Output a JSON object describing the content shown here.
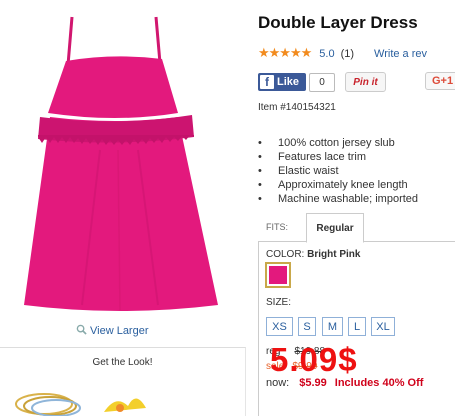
{
  "product": {
    "title": "Double Layer Dress",
    "rating": {
      "stars": "★★★★★",
      "score": "5.0",
      "count": "(1)",
      "write_review": "Write a rev"
    },
    "item_number": "Item #140154321",
    "features": [
      "100% cotton jersey slub",
      "Features lace trim",
      "Elastic waist",
      "Approximately knee length",
      "Machine washable; imported"
    ]
  },
  "social": {
    "fb_like": "Like",
    "fb_icon": "f",
    "fb_count": "0",
    "pinit": "Pin it",
    "gplus": "G+1"
  },
  "gallery": {
    "view_larger": "View Larger",
    "get_the_look": "Get the Look!"
  },
  "fits": {
    "label": "FITS:",
    "selected_tab": "Regular"
  },
  "color": {
    "label": "COLOR:",
    "value": "Bright Pink",
    "swatch_hex": "#e3197d"
  },
  "size": {
    "label": "SIZE:",
    "options": [
      "XS",
      "S",
      "M",
      "L",
      "XL"
    ]
  },
  "pricing": {
    "reg_label": "reg",
    "reg_price": "$19.88",
    "sale_label": "sale",
    "sale_price": "$9.99",
    "now_label": "now:",
    "now_price": "$5.99",
    "discount": "Includes 40% Off",
    "overlay_price": "5.09$"
  },
  "colors": {
    "dress": "#e3197d",
    "link": "#2a5f9e",
    "star": "#f28b1e",
    "sale_red": "#d0021b",
    "overlay_red": "#ee1111"
  }
}
